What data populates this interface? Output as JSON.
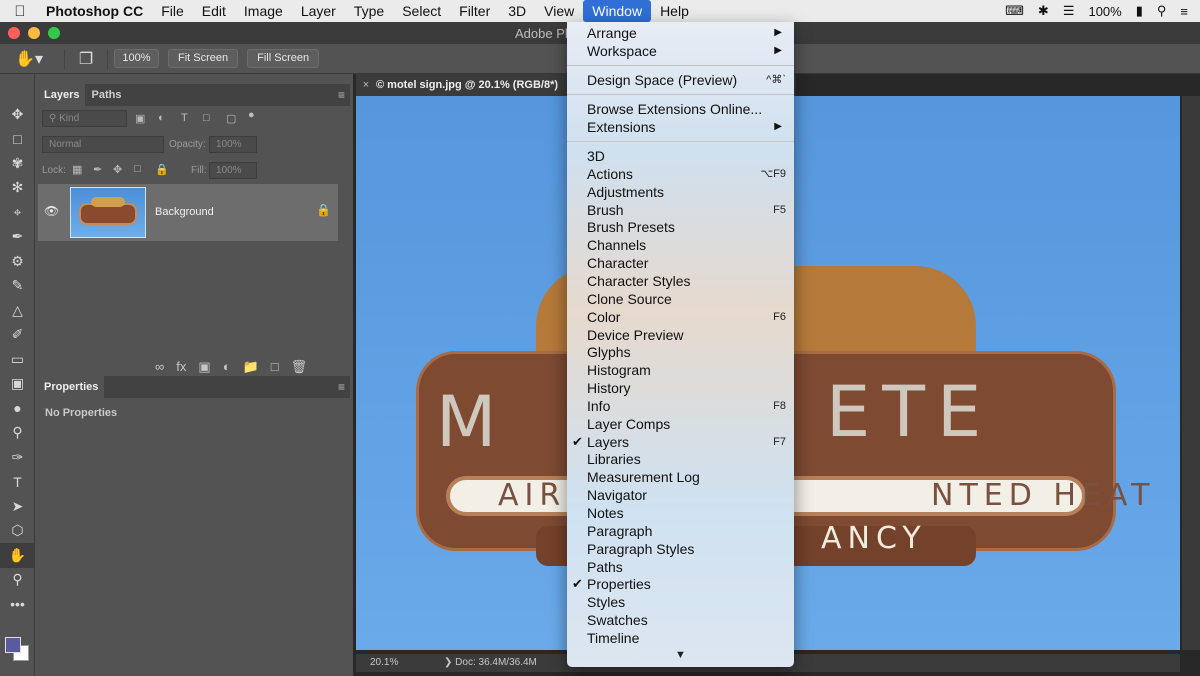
{
  "menubar": {
    "app": "Photoshop CC",
    "items": [
      "File",
      "Edit",
      "Image",
      "Layer",
      "Type",
      "Select",
      "Filter",
      "3D",
      "View",
      "Window",
      "Help"
    ],
    "active": "Window",
    "battery": "100%"
  },
  "titlebar": {
    "title": "Adobe Ph"
  },
  "options": {
    "zoom": "100%",
    "fit_screen": "Fit Screen",
    "fill_screen": "Fill Screen"
  },
  "layers_panel": {
    "tabs": [
      "Layers",
      "Paths"
    ],
    "kind_placeholder": "Kind",
    "blend_mode": "Normal",
    "opacity_label": "Opacity:",
    "opacity_value": "100%",
    "lock_label": "Lock:",
    "fill_label": "Fill:",
    "fill_value": "100%",
    "layer_name": "Background"
  },
  "properties_panel": {
    "tab": "Properties",
    "empty_text": "No Properties"
  },
  "document": {
    "tab_title": "© motel sign.jpg @ 20.1% (RGB/8*)",
    "status_zoom": "20.1%",
    "status_doc": "Doc: 36.4M/36.4M",
    "sign_text": {
      "left": "AIR C",
      "right": "NTED HEAT",
      "lower": "ANCY",
      "big_left": "M",
      "big_right": "ETE"
    }
  },
  "window_menu": {
    "group1": [
      {
        "label": "Arrange",
        "submenu": true
      },
      {
        "label": "Workspace",
        "submenu": true
      }
    ],
    "design_space": {
      "label": "Design Space (Preview)",
      "shortcut": "^⌘`"
    },
    "group3": [
      {
        "label": "Browse Extensions Online..."
      },
      {
        "label": "Extensions",
        "submenu": true
      }
    ],
    "panels": [
      {
        "label": "3D",
        "shortcut": "",
        "checked": false
      },
      {
        "label": "Actions",
        "shortcut": "⌥F9",
        "checked": false
      },
      {
        "label": "Adjustments",
        "shortcut": "",
        "checked": false
      },
      {
        "label": "Brush",
        "shortcut": "F5",
        "checked": false
      },
      {
        "label": "Brush Presets",
        "shortcut": "",
        "checked": false
      },
      {
        "label": "Channels",
        "shortcut": "",
        "checked": false
      },
      {
        "label": "Character",
        "shortcut": "",
        "checked": false
      },
      {
        "label": "Character Styles",
        "shortcut": "",
        "checked": false
      },
      {
        "label": "Clone Source",
        "shortcut": "",
        "checked": false
      },
      {
        "label": "Color",
        "shortcut": "F6",
        "checked": false
      },
      {
        "label": "Device Preview",
        "shortcut": "",
        "checked": false
      },
      {
        "label": "Glyphs",
        "shortcut": "",
        "checked": false
      },
      {
        "label": "Histogram",
        "shortcut": "",
        "checked": false
      },
      {
        "label": "History",
        "shortcut": "",
        "checked": false
      },
      {
        "label": "Info",
        "shortcut": "F8",
        "checked": false
      },
      {
        "label": "Layer Comps",
        "shortcut": "",
        "checked": false
      },
      {
        "label": "Layers",
        "shortcut": "F7",
        "checked": true
      },
      {
        "label": "Libraries",
        "shortcut": "",
        "checked": false
      },
      {
        "label": "Measurement Log",
        "shortcut": "",
        "checked": false
      },
      {
        "label": "Navigator",
        "shortcut": "",
        "checked": false
      },
      {
        "label": "Notes",
        "shortcut": "",
        "checked": false
      },
      {
        "label": "Paragraph",
        "shortcut": "",
        "checked": false
      },
      {
        "label": "Paragraph Styles",
        "shortcut": "",
        "checked": false
      },
      {
        "label": "Paths",
        "shortcut": "",
        "checked": false
      },
      {
        "label": "Properties",
        "shortcut": "",
        "checked": true
      },
      {
        "label": "Styles",
        "shortcut": "",
        "checked": false
      },
      {
        "label": "Swatches",
        "shortcut": "",
        "checked": false
      },
      {
        "label": "Timeline",
        "shortcut": "",
        "checked": false
      }
    ]
  },
  "colors": {
    "menu_highlight": "#2f6fd6",
    "panel_bg": "#535353",
    "canvas_sky": "#5b9be0"
  }
}
